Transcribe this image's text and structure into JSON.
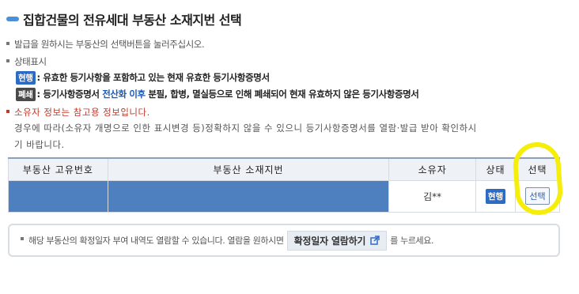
{
  "page_title": "집합건물의 전유세대 부동산 소재지번 선택",
  "instructions": {
    "issue_guide": "발급을 원하시는 부동산의 선택버튼을 눌러주십시오.",
    "status_heading": "상태표시",
    "legend_current_badge": "현행",
    "legend_current_text": ": 유효한 등기사항을 포함하고 있는 현재 유효한 등기사항증명서",
    "legend_closed_badge": "폐쇄",
    "legend_closed_text_a": ": 등기사항증명서 ",
    "legend_closed_text_blue": "전산화 이후",
    "legend_closed_text_b": " 분필, 합병, 멸실등으로 인해 폐쇄되어 현재 유효하지 않은 등기사항증명서",
    "owner_warning": "소유자 정보는 참고용 정보입니다.",
    "owner_note_line1": "경우에 따라(소유자 개명으로 인한 표시변경 등)정확하지 않을 수 있으니 등기사항증명서를 열람·발급 받아 확인하시",
    "owner_note_line2": "기 바랍니다."
  },
  "table": {
    "headers": [
      "부동산 고유번호",
      "부동산 소재지번",
      "소유자",
      "상태",
      "선택"
    ],
    "rows": [
      {
        "unique_number": "",
        "address": "",
        "owner": "김**",
        "status": "현행",
        "select_label": "선택"
      }
    ]
  },
  "info_box": {
    "text_before": "해당 부동산의 확정일자 부여 내역도 열람할 수 있습니다. 열람을 원하시면",
    "button_label": "확정일자 열람하기",
    "text_after": "를 누르세요."
  },
  "colors": {
    "accent": "#2e6bc4",
    "highlight": "#f5ee0a",
    "redaction": "#4e7fbf",
    "warning": "#c0392b"
  }
}
